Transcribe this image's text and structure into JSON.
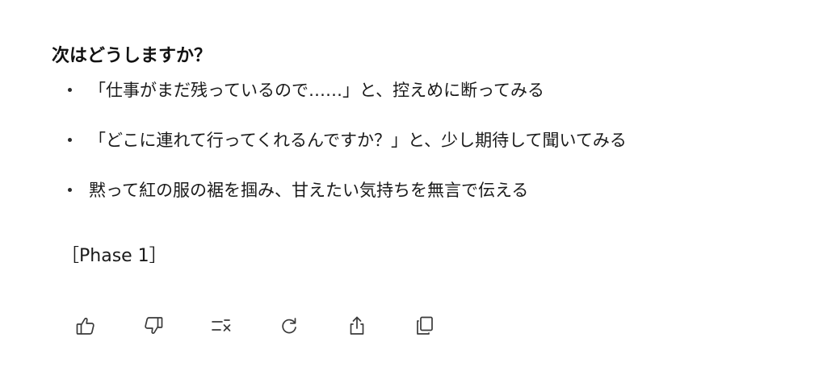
{
  "message": {
    "heading": "次はどうしますか？",
    "options": [
      "「仕事がまだ残っているので……」と、控えめに断ってみる",
      "「どこに連れて行ってくれるんですか？」と、少し期待して聞いてみる",
      "黙って紅の服の裾を掴み、甘えたい気持ちを無言で伝える"
    ],
    "phase": "［Phase 1］"
  },
  "actions": [
    {
      "icon": "thumbs-up-icon"
    },
    {
      "icon": "thumbs-down-icon"
    },
    {
      "icon": "list-dismiss-icon"
    },
    {
      "icon": "refresh-icon"
    },
    {
      "icon": "share-icon"
    },
    {
      "icon": "copy-icon"
    }
  ]
}
